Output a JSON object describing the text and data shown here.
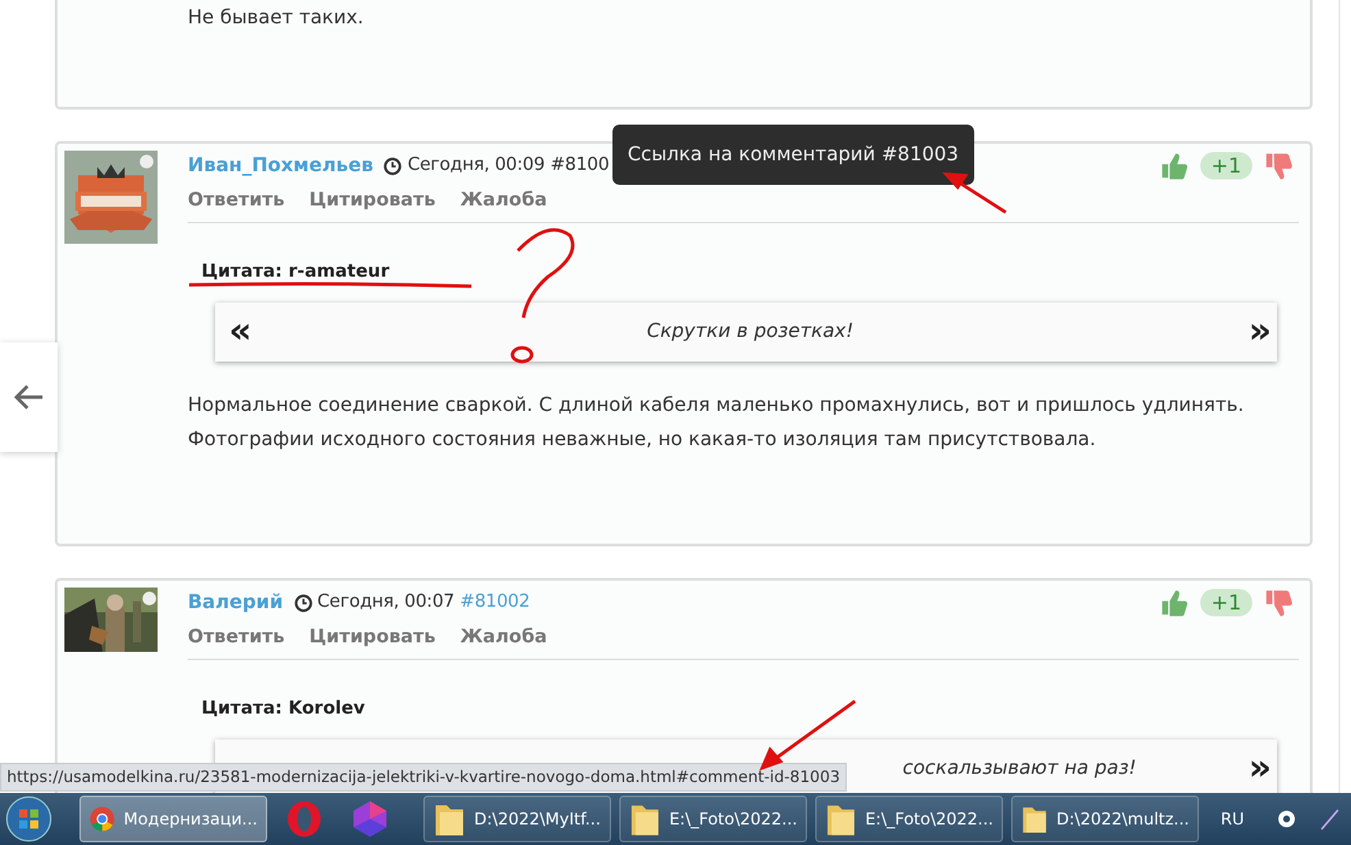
{
  "previous_comment": {
    "body": "Не бывает таких."
  },
  "comments": [
    {
      "author": "Иван_Похмельев",
      "time": "Сегодня, 00:09",
      "number": "#8100",
      "number_hovered": true,
      "actions": [
        "Ответить",
        "Цитировать",
        "Жалоба"
      ],
      "rating": "+1",
      "quote": {
        "label": "Цитата: r-amateur",
        "open_mark": "«",
        "text": "Скрутки в розетках!",
        "close_mark": "»"
      },
      "body": "Нормальное соединение сваркой. С длиной кабеля маленько промахнулись, вот и пришлось удлинять. Фотографии исходного состояния неважные, но какая-то изоляция там присутствовала."
    },
    {
      "author": "Валерий",
      "time": "Сегодня, 00:07",
      "number": "#81002",
      "number_hovered": false,
      "actions": [
        "Ответить",
        "Цитировать",
        "Жалоба"
      ],
      "rating": "+1",
      "quote": {
        "label": "Цитата: Korolev",
        "text": "соскальзывают на раз!",
        "close_mark": "»"
      }
    }
  ],
  "tooltip": {
    "text": "Ссылка на комментарий #81003"
  },
  "status_bar": {
    "url": "https://usamodelkina.ru/23581-modernizacija-jelektriki-v-kvartire-novogo-doma.html#comment-id-81003"
  },
  "taskbar": {
    "items": [
      {
        "kind": "browser",
        "label": "Модернизаци...",
        "selected": true
      },
      {
        "kind": "opera",
        "selected": false
      },
      {
        "kind": "gem",
        "selected": false
      },
      {
        "kind": "folder",
        "label": "D:\\2022\\MyItf...",
        "selected": false
      },
      {
        "kind": "folder",
        "label": "E:\\_Foto\\2022...",
        "selected": false
      },
      {
        "kind": "folder",
        "label": "E:\\_Foto\\2022...",
        "selected": false
      },
      {
        "kind": "folder",
        "label": "D:\\2022\\multz...",
        "selected": false
      }
    ],
    "language": "RU"
  }
}
